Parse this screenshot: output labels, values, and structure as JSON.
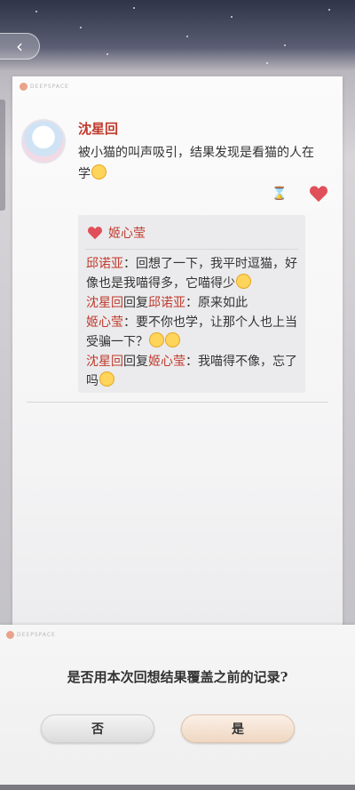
{
  "nav": {
    "back_icon": "chevron-left-icon"
  },
  "card": {
    "brand": "DEEPSPACE",
    "poster_name": "沈星回",
    "post_text": "被小猫的叫声吸引，结果发现是看猫的人在学",
    "comments": {
      "liker": "姬心莹",
      "lines": [
        {
          "author": "邱诺亚",
          "reply_word": "",
          "target": "",
          "text": "：回想了一下，我平时逗猫，好像也是我喵得多，它喵得少"
        },
        {
          "author": "沈星回",
          "reply_word": "回复",
          "target": "邱诺亚",
          "text": "：原来如此"
        },
        {
          "author": "姬心莹",
          "reply_word": "",
          "target": "",
          "text": "：要不你也学，让那个人也上当受骗一下？"
        },
        {
          "author": "沈星回",
          "reply_word": "回复",
          "target": "姬心莹",
          "text": "：我喵得不像，忘了吗"
        }
      ]
    }
  },
  "dialog": {
    "brand": "DEEPSPACE",
    "question": "是否用本次回想结果覆盖之前的记录?",
    "no_label": "否",
    "yes_label": "是"
  },
  "colors": {
    "accent_red": "#c0392b",
    "heart": "#e0505a"
  }
}
